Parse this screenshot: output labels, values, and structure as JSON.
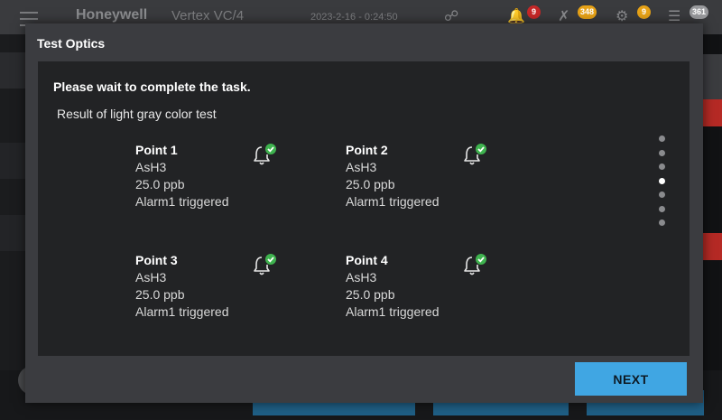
{
  "app": {
    "brand": "Honeywell",
    "device": "Vertex VC/4",
    "datetime": "2023-2-16 - 0:24:50",
    "badges": [
      "9",
      "348",
      "9",
      "361"
    ]
  },
  "dialog": {
    "title": "Test Optics",
    "instruction": "Please wait to complete the task.",
    "subtitle": "Result of light gray color test",
    "points": [
      {
        "name": "Point 1",
        "gas": "AsH3",
        "concentration": "25.0 ppb",
        "status": "Alarm1 triggered"
      },
      {
        "name": "Point 2",
        "gas": "AsH3",
        "concentration": "25.0 ppb",
        "status": "Alarm1 triggered"
      },
      {
        "name": "Point 3",
        "gas": "AsH3",
        "concentration": "25.0 ppb",
        "status": "Alarm1 triggered"
      },
      {
        "name": "Point 4",
        "gas": "AsH3",
        "concentration": "25.0 ppb",
        "status": "Alarm1 triggered"
      }
    ],
    "pagination": {
      "total": 7,
      "current": 4
    },
    "next_label": "NEXT"
  },
  "colors": {
    "accent": "#40a6e3",
    "check": "#3fb34f",
    "badge_red": "#c62828",
    "badge_orange": "#e8a317"
  },
  "icons": {
    "point_status": "bell-check-icon"
  }
}
